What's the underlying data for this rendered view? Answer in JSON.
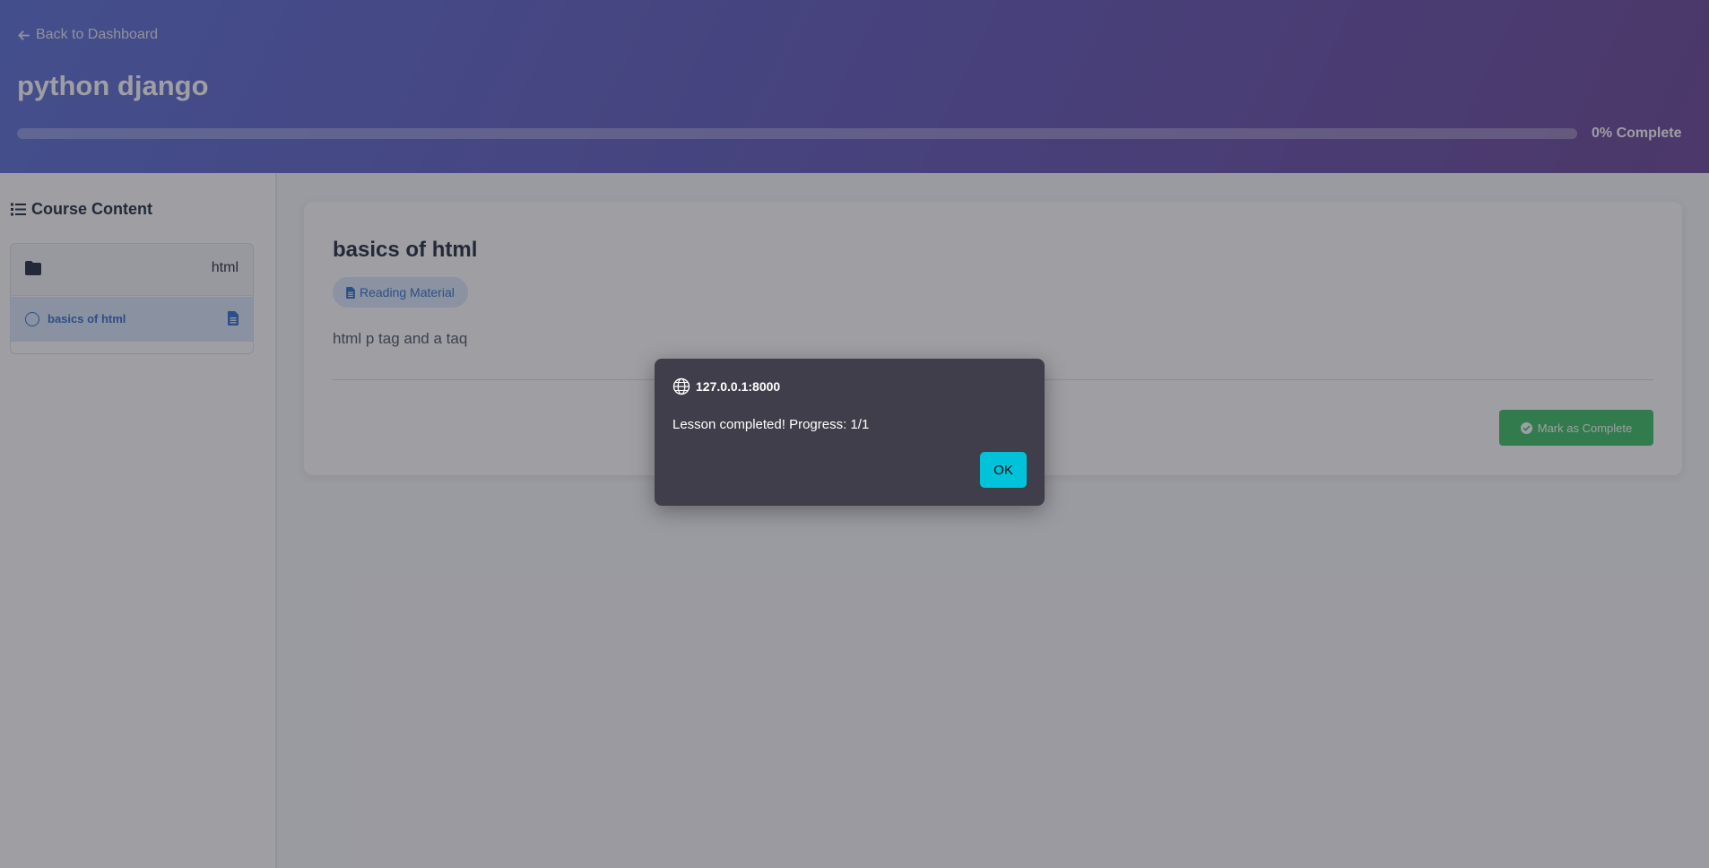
{
  "header": {
    "back_label": "Back to Dashboard",
    "course_title": "python django",
    "progress_percent": 0,
    "progress_text": "0% Complete"
  },
  "sidebar": {
    "heading": "Course Content",
    "modules": [
      {
        "title": "html",
        "icon": "folder-icon",
        "lessons": [
          {
            "label": "basics of html",
            "status_icon": "circle-icon",
            "type_icon": "document-icon",
            "active": true
          }
        ]
      }
    ]
  },
  "lesson": {
    "title": "basics of html",
    "type_label": "Reading Material",
    "type_icon": "document-icon",
    "body": "html p tag and a taq",
    "complete_button_label": "Mark as Complete"
  },
  "dialog": {
    "origin": "127.0.0.1:8000",
    "message": "Lesson completed! Progress: 1/1",
    "ok_label": "OK"
  },
  "colors": {
    "header_gradient_start": "#5a6fd6",
    "header_gradient_end": "#6a4596",
    "accent_blue": "#2f6fd1",
    "success_green": "#3bbf63",
    "dialog_bg": "#403e4a",
    "dialog_ok": "#00c2d9"
  }
}
